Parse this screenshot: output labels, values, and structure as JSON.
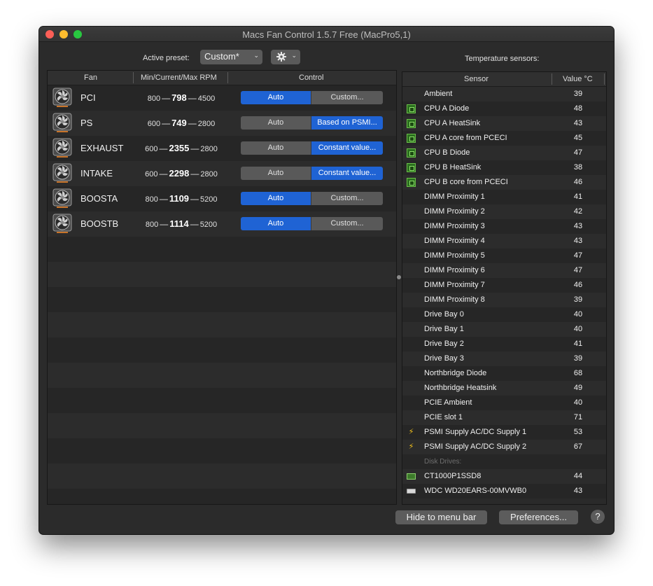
{
  "window": {
    "title": "Macs Fan Control 1.5.7 Free (MacPro5,1)"
  },
  "toolbar": {
    "preset_label": "Active preset:",
    "preset_value": "Custom*",
    "chevron": "⌄",
    "temp_title": "Temperature sensors:"
  },
  "fan_table": {
    "headers": {
      "fan": "Fan",
      "rpm": "Min/Current/Max RPM",
      "control": "Control"
    },
    "dash": "—",
    "rows": [
      {
        "name": "PCI",
        "min": "800",
        "current": "798",
        "max": "4500",
        "auto": "Auto",
        "other": "Custom...",
        "mode": "auto"
      },
      {
        "name": "PS",
        "min": "600",
        "current": "749",
        "max": "2800",
        "auto": "Auto",
        "other": "Based on PSMI...",
        "mode": "other"
      },
      {
        "name": "EXHAUST",
        "min": "600",
        "current": "2355",
        "max": "2800",
        "auto": "Auto",
        "other": "Constant value...",
        "mode": "other"
      },
      {
        "name": "INTAKE",
        "min": "600",
        "current": "2298",
        "max": "2800",
        "auto": "Auto",
        "other": "Constant value...",
        "mode": "other"
      },
      {
        "name": "BOOSTA",
        "min": "800",
        "current": "1109",
        "max": "5200",
        "auto": "Auto",
        "other": "Custom...",
        "mode": "auto"
      },
      {
        "name": "BOOSTB",
        "min": "800",
        "current": "1114",
        "max": "5200",
        "auto": "Auto",
        "other": "Custom...",
        "mode": "auto"
      }
    ]
  },
  "sensor_table": {
    "headers": {
      "sensor": "Sensor",
      "value": "Value °C"
    },
    "rows": [
      {
        "name": "Ambient",
        "value": "39",
        "icon": "none"
      },
      {
        "name": "CPU A Diode",
        "value": "48",
        "icon": "cpu-chip-icon"
      },
      {
        "name": "CPU A HeatSink",
        "value": "43",
        "icon": "cpu-chip-icon"
      },
      {
        "name": "CPU A core from PCECI",
        "value": "45",
        "icon": "cpu-chip-icon"
      },
      {
        "name": "CPU B Diode",
        "value": "47",
        "icon": "cpu-chip-icon"
      },
      {
        "name": "CPU B HeatSink",
        "value": "38",
        "icon": "cpu-chip-icon"
      },
      {
        "name": "CPU B core from PCECI",
        "value": "46",
        "icon": "cpu-chip-icon"
      },
      {
        "name": "DIMM Proximity 1",
        "value": "41",
        "icon": "none"
      },
      {
        "name": "DIMM Proximity 2",
        "value": "42",
        "icon": "none"
      },
      {
        "name": "DIMM Proximity 3",
        "value": "43",
        "icon": "none"
      },
      {
        "name": "DIMM Proximity 4",
        "value": "43",
        "icon": "none"
      },
      {
        "name": "DIMM Proximity 5",
        "value": "47",
        "icon": "none"
      },
      {
        "name": "DIMM Proximity 6",
        "value": "47",
        "icon": "none"
      },
      {
        "name": "DIMM Proximity 7",
        "value": "46",
        "icon": "none"
      },
      {
        "name": "DIMM Proximity 8",
        "value": "39",
        "icon": "none"
      },
      {
        "name": "Drive Bay 0",
        "value": "40",
        "icon": "none"
      },
      {
        "name": "Drive Bay 1",
        "value": "40",
        "icon": "none"
      },
      {
        "name": "Drive Bay 2",
        "value": "41",
        "icon": "none"
      },
      {
        "name": "Drive Bay 3",
        "value": "39",
        "icon": "none"
      },
      {
        "name": "Northbridge Diode",
        "value": "68",
        "icon": "none"
      },
      {
        "name": "Northbridge Heatsink",
        "value": "49",
        "icon": "none"
      },
      {
        "name": "PCIE Ambient",
        "value": "40",
        "icon": "none"
      },
      {
        "name": "PCIE slot 1",
        "value": "71",
        "icon": "none"
      },
      {
        "name": "PSMI Supply AC/DC Supply 1",
        "value": "53",
        "icon": "power-bolt-icon"
      },
      {
        "name": "PSMI Supply AC/DC Supply 2",
        "value": "67",
        "icon": "power-bolt-icon"
      },
      {
        "name": "Disk Drives:",
        "value": "",
        "icon": "none",
        "section": true
      },
      {
        "name": "CT1000P1SSD8",
        "value": "44",
        "icon": "ssd-icon"
      },
      {
        "name": "WDC WD20EARS-00MVWB0",
        "value": "43",
        "icon": "hdd-icon"
      }
    ]
  },
  "buttons": {
    "hide": "Hide to menu bar",
    "preferences": "Preferences...",
    "help": "?"
  },
  "colors": {
    "accent": "#1f63d4",
    "window_bg": "#2b2b2b",
    "segment_off": "#595959",
    "chip_green": "#6cc04a",
    "bolt_yellow": "#f4c21b"
  }
}
